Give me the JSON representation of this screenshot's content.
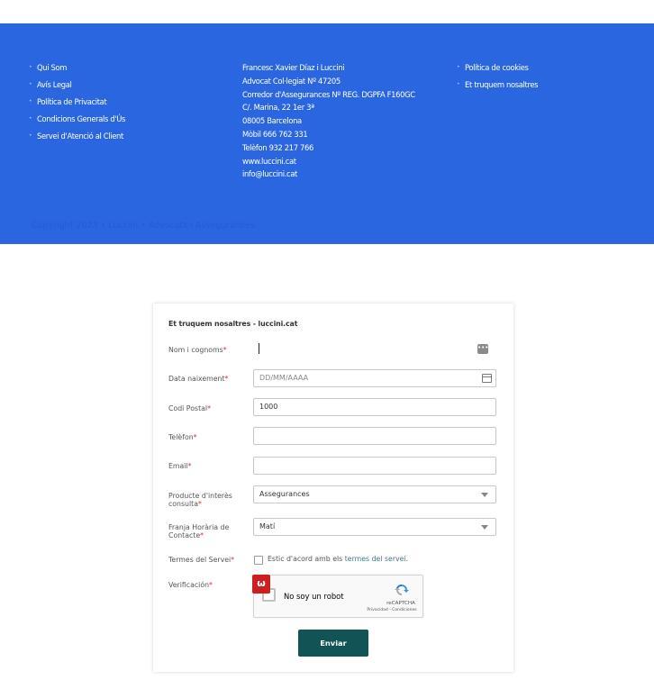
{
  "footer": {
    "links_left": [
      "Qui Som",
      "Avís Legal",
      "Política de Privacitat",
      "Condicions Generals d'Ús",
      "Servei d'Atenció al Client"
    ],
    "address": [
      "Francesc Xavier Díaz i Luccini",
      "Advocat Col·legiat Nº 47205",
      "Corredor d'Assegurances Nº REG. DGPFA F160GC",
      "C/. Marina, 22 1er 3ª",
      "08005 Barcelona",
      "Mòbil 666 762 331",
      "Telèfon 932 217 766",
      "www.luccini.cat",
      "info@luccini.cat"
    ],
    "links_right": [
      "Política de cookies",
      "Et truquem nosaltres"
    ],
    "ghost_text": "Copyright 2023 • Luccini • Advocats i Assegurances"
  },
  "form": {
    "title": "Et truquem nosaltres - luccini.cat",
    "fields": {
      "nom": {
        "label": "Nom i cognoms",
        "value": ""
      },
      "data": {
        "label": "Data naixement",
        "placeholder": "DD/MM/AAAA"
      },
      "cp": {
        "label": "Codi Postal",
        "value": "1000"
      },
      "tel": {
        "label": "Telèfon",
        "value": ""
      },
      "email": {
        "label": "Email",
        "value": ""
      },
      "producte": {
        "label_line1": "Producte d'interès",
        "label_line2": "consulta",
        "value": "Assegurances"
      },
      "franja": {
        "label_line1": "Franja Horària de",
        "label_line2": "Contacte",
        "value": "Matí"
      },
      "termes": {
        "label": "Termes del Servei",
        "text": "Estic d'acord amb els ",
        "link": "termes del servei",
        "suffix": "."
      },
      "verificacio": {
        "label": "Verificación"
      }
    },
    "recaptcha": {
      "label": "No soy un robot",
      "brand": "reCAPTCHA",
      "links": "Privacidad - Condiciones"
    },
    "badge_icon": "w-logo-icon",
    "submit_label": "Enviar"
  },
  "colors": {
    "footer_bg": "#2a66e0",
    "button_bg": "#125456",
    "required": "#d32f2f"
  }
}
